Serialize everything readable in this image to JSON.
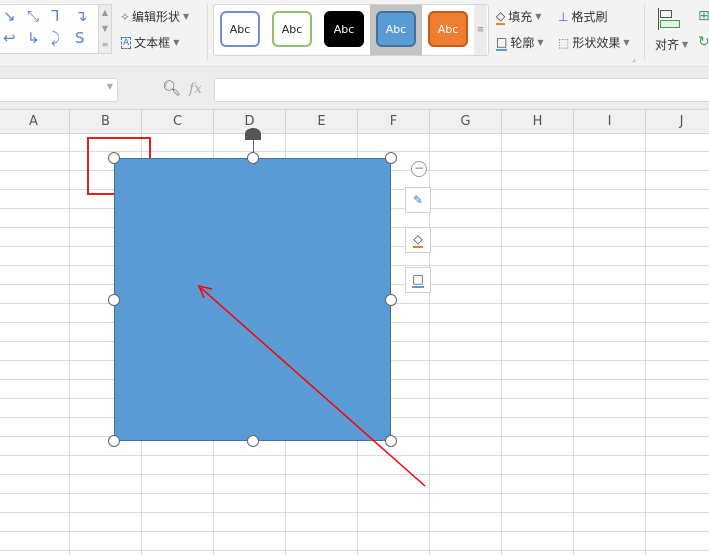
{
  "ribbon": {
    "connectors": [
      "↘",
      "⤡",
      "⅂",
      "↴",
      "↩",
      "↳",
      "⤸",
      "S"
    ],
    "edit_shape": "编辑形状",
    "text_box": "文本框",
    "styles": [
      {
        "label": "Abc",
        "bg": "#ffffff",
        "border": "#6f8fd0",
        "color": "#222"
      },
      {
        "label": "Abc",
        "bg": "#ffffff",
        "border": "#8fbf6a",
        "color": "#222"
      },
      {
        "label": "Abc",
        "bg": "#000000",
        "border": "#000000",
        "color": "#ffffff"
      },
      {
        "label": "Abc",
        "bg": "#5b9bd5",
        "border": "#41719c",
        "color": "#ffffff",
        "selected": true
      },
      {
        "label": "Abc",
        "bg": "#ed7d31",
        "border": "#c55a11",
        "color": "#ffffff"
      }
    ],
    "fill": "填充",
    "format_painter": "格式刷",
    "outline": "轮廓",
    "shape_effects": "形状效果",
    "align": "对齐"
  },
  "formula_bar": {
    "fx": "fx",
    "value": ""
  },
  "columns": [
    "A",
    "B",
    "C",
    "D",
    "E",
    "F",
    "G",
    "H",
    "I",
    "J"
  ],
  "shape": {
    "fill": "#5b9bd5"
  },
  "annotation": {
    "color": "#ff0000"
  }
}
